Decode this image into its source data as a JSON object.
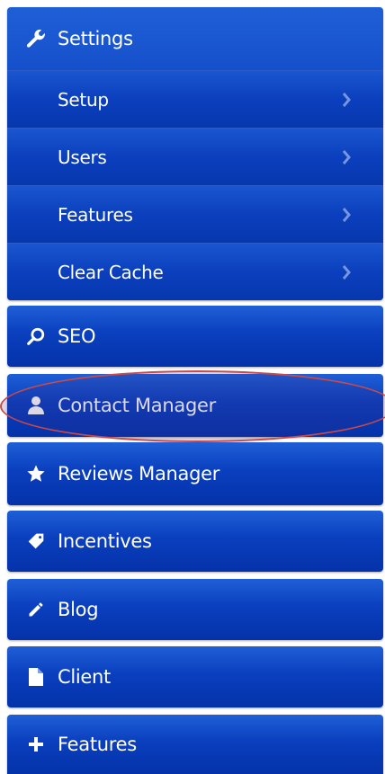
{
  "menu": {
    "settings": {
      "label": "Settings",
      "icon": "wrench-icon",
      "sub_items": [
        {
          "label": "Setup"
        },
        {
          "label": "Users"
        },
        {
          "label": "Features"
        },
        {
          "label": "Clear Cache"
        }
      ]
    },
    "seo": {
      "label": "SEO",
      "icon": "search-icon"
    },
    "contact_manager": {
      "label": "Contact Manager",
      "icon": "user-icon",
      "highlighted": true
    },
    "reviews_manager": {
      "label": "Reviews Manager",
      "icon": "star-icon"
    },
    "incentives": {
      "label": "Incentives",
      "icon": "tag-icon"
    },
    "blog": {
      "label": "Blog",
      "icon": "pencil-icon"
    },
    "client": {
      "label": "Client",
      "icon": "document-icon"
    },
    "features": {
      "label": "Features",
      "icon": "plus-icon"
    }
  },
  "colors": {
    "panel_top": "#1f5fd6",
    "panel_bottom": "#0432a9",
    "text": "#ffffff",
    "highlight_ring": "#c94a4a"
  }
}
